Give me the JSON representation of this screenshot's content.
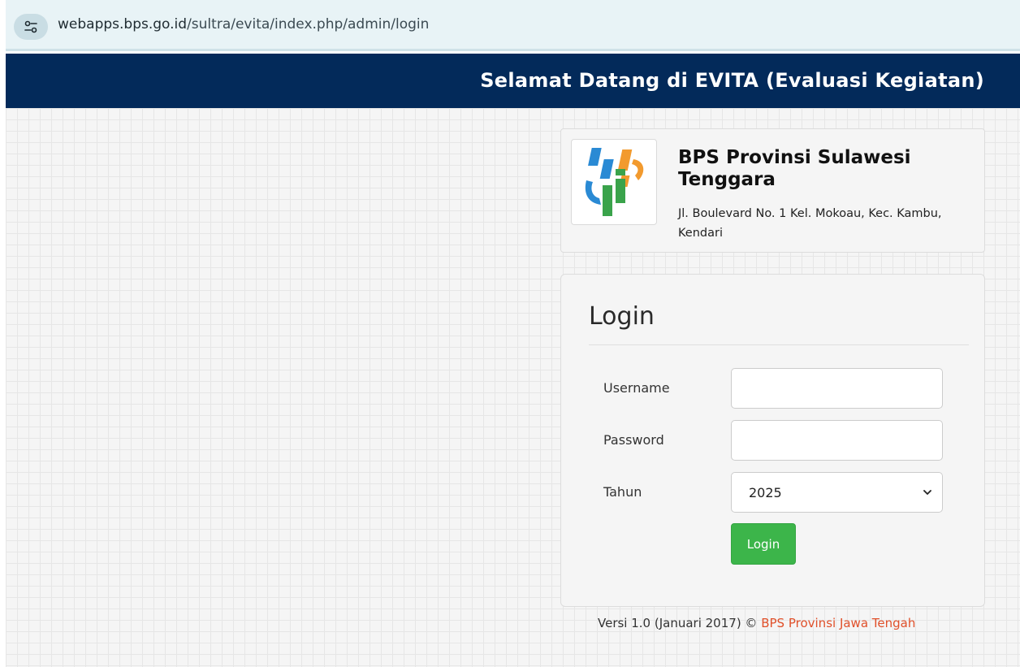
{
  "browser": {
    "url_host": "webapps.bps.go.id",
    "url_path": "/sultra/evita/index.php/admin/login"
  },
  "header": {
    "title": "Selamat Datang di EVITA (Evaluasi Kegiatan)",
    "background": "#032a5a"
  },
  "institution": {
    "name": "BPS Provinsi Sulawesi Tenggara",
    "address": "Jl. Boulevard No. 1 Kel. Mokoau, Kec. Kambu, Kendari",
    "logo_icon": "bps-logo-icon"
  },
  "login": {
    "title": "Login",
    "username_label": "Username",
    "username_value": "",
    "password_label": "Password",
    "password_value": "",
    "year_label": "Tahun",
    "year_selected": "2025",
    "submit_label": "Login",
    "button_color": "#3cb54a"
  },
  "footer": {
    "version_text": "Versi 1.0 (Januari 2017) © ",
    "link_text": "BPS Provinsi Jawa Tengah",
    "link_color": "#e0502a"
  }
}
